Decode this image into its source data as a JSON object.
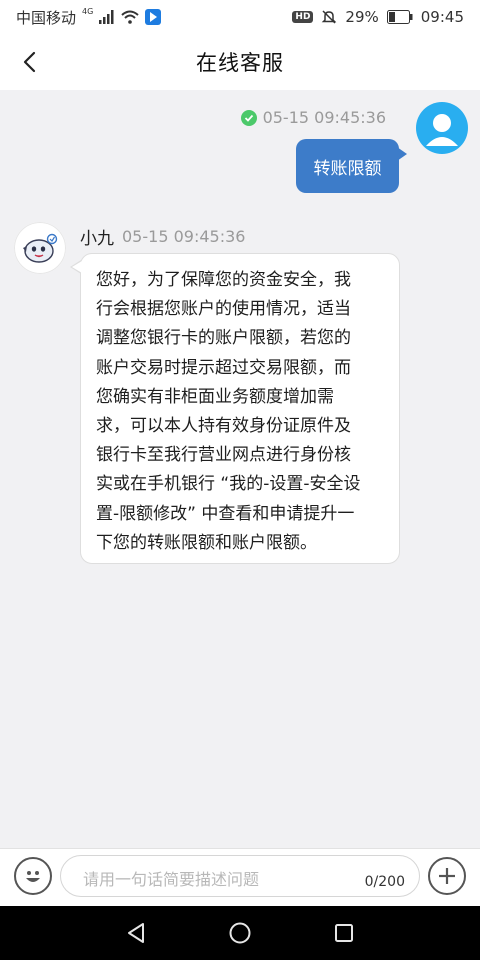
{
  "status_bar": {
    "carrier": "中国移动",
    "network": "4G",
    "battery": "29%",
    "time": "09:45",
    "hd_badge": "HD"
  },
  "header": {
    "title": "在线客服",
    "back_icon": "chevron-left-icon"
  },
  "chat": {
    "user_message": {
      "timestamp": "05-15 09:45:36",
      "text": "转账限额",
      "status_icon": "check-circle-icon",
      "status_color": "#4cc96a",
      "bubble_color": "#3d7cc9",
      "avatar_icon": "user-avatar-icon"
    },
    "bot_message": {
      "name": "小九",
      "timestamp": "05-15 09:45:36",
      "avatar_icon": "mascot-avatar-icon",
      "lines": [
        "您好，为了保障您的资金安全，我",
        "行会根据您账户的使用情况，适当",
        "调整您银行卡的账户限额，若您的",
        "账户交易时提示超过交易限额，而",
        "您确实有非柜面业务额度增加需",
        "求，可以本人持有效身份证原件及",
        "银行卡至我行营业网点进行身份核",
        "实或在手机银行 “我的-设置-安全设",
        "置-限额修改” 中查看和申请提升一",
        "下您的转账限额和账户限额。"
      ]
    }
  },
  "input_bar": {
    "placeholder": "请用一句话简要描述问题",
    "counter": "0/200",
    "emoji_icon": "emoji-icon",
    "plus_icon": "plus-icon"
  },
  "nav_bar": {
    "back_icon": "nav-back-icon",
    "home_icon": "nav-home-icon",
    "recents_icon": "nav-recents-icon"
  },
  "colors": {
    "accent": "#3d7cc9",
    "user_avatar_bg": "#29aef0",
    "chat_bg": "#f1f1f3"
  }
}
